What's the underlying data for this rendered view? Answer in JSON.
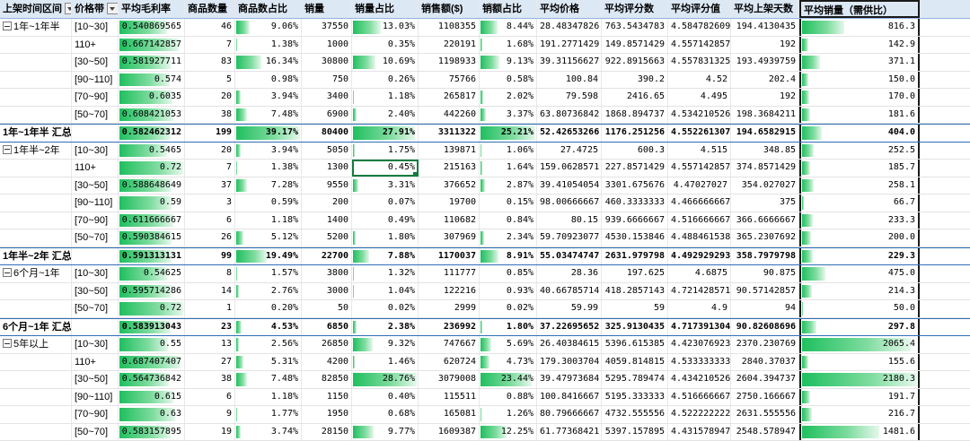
{
  "columns": [
    "上架时间区间",
    "价格带",
    "平均毛利率",
    "商品数量",
    "商品数占比",
    "销量",
    "销量占比",
    "销售额($)",
    "销额占比",
    "平均价格",
    "平均评分数",
    "平均评分值",
    "平均上架天数",
    "平均销量（需供比）"
  ],
  "rows": [
    {
      "type": "data",
      "group": "1年~1年半",
      "groupStart": true,
      "price": "[10~30]",
      "margin": "0.540869565",
      "count": "46",
      "countPct": "9.06%",
      "sales": "37550",
      "salesPct": "13.03%",
      "revenue": "1108355",
      "revPct": "8.44%",
      "avgPrice": "28.48347826",
      "avgRatings": "763.5434783",
      "avgScore": "4.584782609",
      "avgDays": "194.4130435",
      "avgSales": "816.3"
    },
    {
      "type": "data",
      "group": "",
      "price": "110+",
      "margin": "0.667142857",
      "count": "7",
      "countPct": "1.38%",
      "sales": "1000",
      "salesPct": "0.35%",
      "revenue": "220191",
      "revPct": "1.68%",
      "avgPrice": "191.2771429",
      "avgRatings": "149.8571429",
      "avgScore": "4.557142857",
      "avgDays": "192",
      "avgSales": "142.9"
    },
    {
      "type": "data",
      "group": "",
      "price": "[30~50]",
      "margin": "0.581927711",
      "count": "83",
      "countPct": "16.34%",
      "sales": "30800",
      "salesPct": "10.69%",
      "revenue": "1198933",
      "revPct": "9.13%",
      "avgPrice": "39.31156627",
      "avgRatings": "922.8915663",
      "avgScore": "4.557831325",
      "avgDays": "193.4939759",
      "avgSales": "371.1"
    },
    {
      "type": "data",
      "group": "",
      "price": "[90~110]",
      "margin": "0.574",
      "count": "5",
      "countPct": "0.98%",
      "sales": "750",
      "salesPct": "0.26%",
      "revenue": "75766",
      "revPct": "0.58%",
      "avgPrice": "100.84",
      "avgRatings": "390.2",
      "avgScore": "4.52",
      "avgDays": "202.4",
      "avgSales": "150.0"
    },
    {
      "type": "data",
      "group": "",
      "price": "[70~90]",
      "margin": "0.6035",
      "count": "20",
      "countPct": "3.94%",
      "sales": "3400",
      "salesPct": "1.18%",
      "revenue": "265817",
      "revPct": "2.02%",
      "avgPrice": "79.598",
      "avgRatings": "2416.65",
      "avgScore": "4.495",
      "avgDays": "192",
      "avgSales": "170.0"
    },
    {
      "type": "data",
      "group": "",
      "price": "[50~70]",
      "margin": "0.608421053",
      "count": "38",
      "countPct": "7.48%",
      "sales": "6900",
      "salesPct": "2.40%",
      "revenue": "442260",
      "revPct": "3.37%",
      "avgPrice": "63.80736842",
      "avgRatings": "1868.894737",
      "avgScore": "4.534210526",
      "avgDays": "198.3684211",
      "avgSales": "181.6"
    },
    {
      "type": "subtotal",
      "group": "1年~1年半 汇总",
      "price": "",
      "margin": "0.582462312",
      "count": "199",
      "countPct": "39.17%",
      "sales": "80400",
      "salesPct": "27.91%",
      "revenue": "3311322",
      "revPct": "25.21%",
      "avgPrice": "52.42653266",
      "avgRatings": "1176.251256",
      "avgScore": "4.552261307",
      "avgDays": "194.6582915",
      "avgSales": "404.0"
    },
    {
      "type": "data",
      "group": "1年半~2年",
      "groupStart": true,
      "price": "[10~30]",
      "margin": "0.5465",
      "count": "20",
      "countPct": "3.94%",
      "sales": "5050",
      "salesPct": "1.75%",
      "revenue": "139871",
      "revPct": "1.06%",
      "avgPrice": "27.4725",
      "avgRatings": "600.3",
      "avgScore": "4.515",
      "avgDays": "348.85",
      "avgSales": "252.5"
    },
    {
      "type": "data",
      "group": "",
      "price": "110+",
      "margin": "0.72",
      "count": "7",
      "countPct": "1.38%",
      "sales": "1300",
      "salesPct": "0.45%",
      "revenue": "215163",
      "revPct": "1.64%",
      "avgPrice": "159.0628571",
      "avgRatings": "227.8571429",
      "avgScore": "4.557142857",
      "avgDays": "374.8571429",
      "avgSales": "185.7",
      "selected": true
    },
    {
      "type": "data",
      "group": "",
      "price": "[30~50]",
      "margin": "0.588648649",
      "count": "37",
      "countPct": "7.28%",
      "sales": "9550",
      "salesPct": "3.31%",
      "revenue": "376652",
      "revPct": "2.87%",
      "avgPrice": "39.41054054",
      "avgRatings": "3301.675676",
      "avgScore": "4.47027027",
      "avgDays": "354.027027",
      "avgSales": "258.1"
    },
    {
      "type": "data",
      "group": "",
      "price": "[90~110]",
      "margin": "0.59",
      "count": "3",
      "countPct": "0.59%",
      "sales": "200",
      "salesPct": "0.07%",
      "revenue": "19700",
      "revPct": "0.15%",
      "avgPrice": "98.00666667",
      "avgRatings": "460.3333333",
      "avgScore": "4.466666667",
      "avgDays": "375",
      "avgSales": "66.7"
    },
    {
      "type": "data",
      "group": "",
      "price": "[70~90]",
      "margin": "0.611666667",
      "count": "6",
      "countPct": "1.18%",
      "sales": "1400",
      "salesPct": "0.49%",
      "revenue": "110682",
      "revPct": "0.84%",
      "avgPrice": "80.15",
      "avgRatings": "939.6666667",
      "avgScore": "4.516666667",
      "avgDays": "366.6666667",
      "avgSales": "233.3"
    },
    {
      "type": "data",
      "group": "",
      "price": "[50~70]",
      "margin": "0.590384615",
      "count": "26",
      "countPct": "5.12%",
      "sales": "5200",
      "salesPct": "1.80%",
      "revenue": "307969",
      "revPct": "2.34%",
      "avgPrice": "59.70923077",
      "avgRatings": "4530.153846",
      "avgScore": "4.488461538",
      "avgDays": "365.2307692",
      "avgSales": "200.0"
    },
    {
      "type": "subtotal",
      "group": "1年半~2年 汇总",
      "price": "",
      "margin": "0.591313131",
      "count": "99",
      "countPct": "19.49%",
      "sales": "22700",
      "salesPct": "7.88%",
      "revenue": "1170037",
      "revPct": "8.91%",
      "avgPrice": "55.03474747",
      "avgRatings": "2631.979798",
      "avgScore": "4.492929293",
      "avgDays": "358.7979798",
      "avgSales": "229.3"
    },
    {
      "type": "data",
      "group": "6个月~1年",
      "groupStart": true,
      "price": "[10~30]",
      "margin": "0.54625",
      "count": "8",
      "countPct": "1.57%",
      "sales": "3800",
      "salesPct": "1.32%",
      "revenue": "111777",
      "revPct": "0.85%",
      "avgPrice": "28.36",
      "avgRatings": "197.625",
      "avgScore": "4.6875",
      "avgDays": "90.875",
      "avgSales": "475.0"
    },
    {
      "type": "data",
      "group": "",
      "price": "[30~50]",
      "margin": "0.595714286",
      "count": "14",
      "countPct": "2.76%",
      "sales": "3000",
      "salesPct": "1.04%",
      "revenue": "122216",
      "revPct": "0.93%",
      "avgPrice": "40.66785714",
      "avgRatings": "418.2857143",
      "avgScore": "4.721428571",
      "avgDays": "90.57142857",
      "avgSales": "214.3"
    },
    {
      "type": "data",
      "group": "",
      "price": "[50~70]",
      "margin": "0.72",
      "count": "1",
      "countPct": "0.20%",
      "sales": "50",
      "salesPct": "0.02%",
      "revenue": "2999",
      "revPct": "0.02%",
      "avgPrice": "59.99",
      "avgRatings": "59",
      "avgScore": "4.9",
      "avgDays": "94",
      "avgSales": "50.0"
    },
    {
      "type": "subtotal",
      "group": "6个月~1年 汇总",
      "price": "",
      "margin": "0.583913043",
      "count": "23",
      "countPct": "4.53%",
      "sales": "6850",
      "salesPct": "2.38%",
      "revenue": "236992",
      "revPct": "1.80%",
      "avgPrice": "37.22695652",
      "avgRatings": "325.9130435",
      "avgScore": "4.717391304",
      "avgDays": "90.82608696",
      "avgSales": "297.8"
    },
    {
      "type": "data",
      "group": "5年以上",
      "groupStart": true,
      "price": "[10~30]",
      "margin": "0.55",
      "count": "13",
      "countPct": "2.56%",
      "sales": "26850",
      "salesPct": "9.32%",
      "revenue": "747667",
      "revPct": "5.69%",
      "avgPrice": "26.40384615",
      "avgRatings": "5396.615385",
      "avgScore": "4.423076923",
      "avgDays": "2370.230769",
      "avgSales": "2065.4"
    },
    {
      "type": "data",
      "group": "",
      "price": "110+",
      "margin": "0.687407407",
      "count": "27",
      "countPct": "5.31%",
      "sales": "4200",
      "salesPct": "1.46%",
      "revenue": "620724",
      "revPct": "4.73%",
      "avgPrice": "179.3003704",
      "avgRatings": "4059.814815",
      "avgScore": "4.533333333",
      "avgDays": "2840.37037",
      "avgSales": "155.6"
    },
    {
      "type": "data",
      "group": "",
      "price": "[30~50]",
      "margin": "0.564736842",
      "count": "38",
      "countPct": "7.48%",
      "sales": "82850",
      "salesPct": "28.76%",
      "revenue": "3079008",
      "revPct": "23.44%",
      "avgPrice": "39.47973684",
      "avgRatings": "5295.789474",
      "avgScore": "4.434210526",
      "avgDays": "2604.394737",
      "avgSales": "2180.3"
    },
    {
      "type": "data",
      "group": "",
      "price": "[90~110]",
      "margin": "0.615",
      "count": "6",
      "countPct": "1.18%",
      "sales": "1150",
      "salesPct": "0.40%",
      "revenue": "115511",
      "revPct": "0.88%",
      "avgPrice": "100.8416667",
      "avgRatings": "5195.333333",
      "avgScore": "4.516666667",
      "avgDays": "2750.166667",
      "avgSales": "191.7"
    },
    {
      "type": "data",
      "group": "",
      "price": "[70~90]",
      "margin": "0.63",
      "count": "9",
      "countPct": "1.77%",
      "sales": "1950",
      "salesPct": "0.68%",
      "revenue": "165081",
      "revPct": "1.26%",
      "avgPrice": "80.79666667",
      "avgRatings": "4732.555556",
      "avgScore": "4.522222222",
      "avgDays": "2631.555556",
      "avgSales": "216.7"
    },
    {
      "type": "data",
      "group": "",
      "price": "[50~70]",
      "margin": "0.583157895",
      "count": "19",
      "countPct": "3.74%",
      "sales": "28150",
      "salesPct": "9.77%",
      "revenue": "1609387",
      "revPct": "12.25%",
      "avgPrice": "61.77368421",
      "avgRatings": "5397.157895",
      "avgScore": "4.431578947",
      "avgDays": "2548.578947",
      "avgSales": "1481.6"
    }
  ],
  "colors": {
    "header_bg": "#dde8f5",
    "bar_green": "#1fbf5f",
    "subtotal_border": "#2f6fb5",
    "selection": "#107c41"
  }
}
